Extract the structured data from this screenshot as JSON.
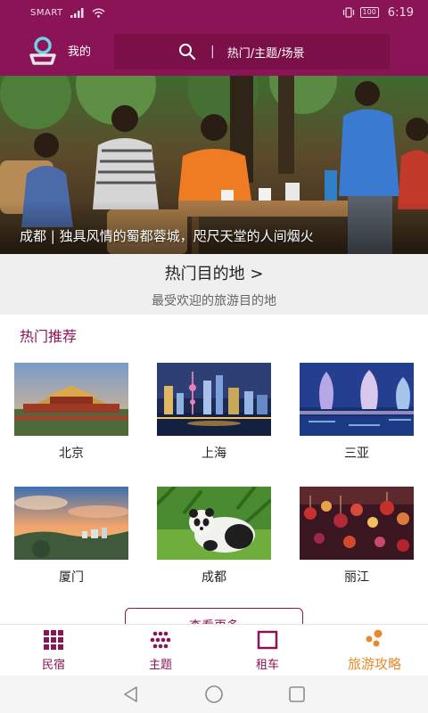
{
  "status_bar": {
    "carrier": "SMART",
    "battery": "100",
    "time": "6:19"
  },
  "header": {
    "profile_label": "我的",
    "search_placeholder": "热门/主题/场景",
    "search_separator": "|"
  },
  "hero": {
    "caption": "成都 | 独具风情的蜀都蓉城，咫尺天堂的人间烟火"
  },
  "destinations_banner": {
    "title": "热门目的地 >",
    "subtitle": "最受欢迎的旅游目的地"
  },
  "recommendations": {
    "title": "热门推荐",
    "items": [
      {
        "name": "北京",
        "icon": "forbidden-city-photo"
      },
      {
        "name": "上海",
        "icon": "shanghai-skyline-photo"
      },
      {
        "name": "三亚",
        "icon": "sanya-towers-photo"
      },
      {
        "name": "厦门",
        "icon": "xiamen-sunset-photo"
      },
      {
        "name": "成都",
        "icon": "panda-photo"
      },
      {
        "name": "丽江",
        "icon": "lanterns-photo"
      }
    ],
    "more_label": "查看更多"
  },
  "bottom_nav": {
    "items": [
      {
        "label": "民宿",
        "icon": "grid-icon"
      },
      {
        "label": "主题",
        "icon": "dots-icon"
      },
      {
        "label": "租车",
        "icon": "square-icon"
      },
      {
        "label": "旅游攻略",
        "icon": "guide-icon",
        "active": true
      }
    ]
  },
  "colors": {
    "brand": "#8b1457",
    "accent": "#e8892a"
  }
}
